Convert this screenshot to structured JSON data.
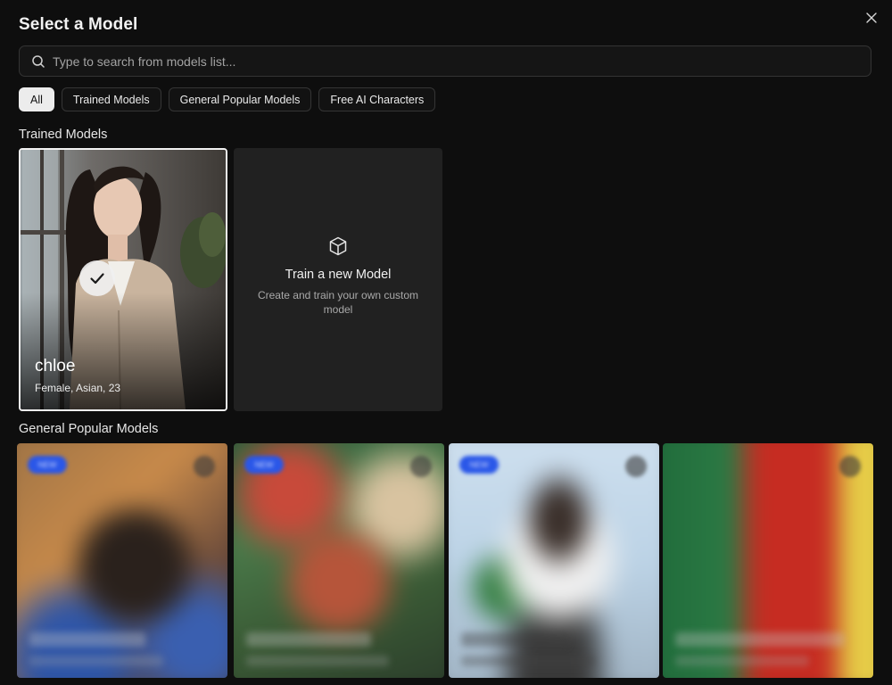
{
  "header": {
    "title": "Select a Model"
  },
  "search": {
    "placeholder": "Type to search from models list..."
  },
  "tabs": [
    {
      "label": "All",
      "active": true
    },
    {
      "label": "Trained Models",
      "active": false
    },
    {
      "label": "General Popular Models",
      "active": false
    },
    {
      "label": "Free AI Characters",
      "active": false
    }
  ],
  "trained_section": {
    "title": "Trained Models",
    "model": {
      "name": "chloe",
      "meta": "Female, Asian, 23",
      "selected": true
    },
    "new_model": {
      "title": "Train a new Model",
      "description": "Create and train your own custom model"
    }
  },
  "popular_section": {
    "title": "General Popular Models",
    "cards": [
      {
        "badge": "NEW"
      },
      {
        "badge": "NEW"
      },
      {
        "badge": "NEW"
      },
      {
        "badge": ""
      }
    ]
  },
  "icons": {
    "close": "close-icon",
    "search": "search-icon",
    "check": "check-icon",
    "cube": "cube-icon"
  },
  "colors": {
    "background": "#0e0e0e",
    "panel": "#212121",
    "border": "#343434",
    "active_tab": "#ececec",
    "badge": "#2a57e8"
  }
}
